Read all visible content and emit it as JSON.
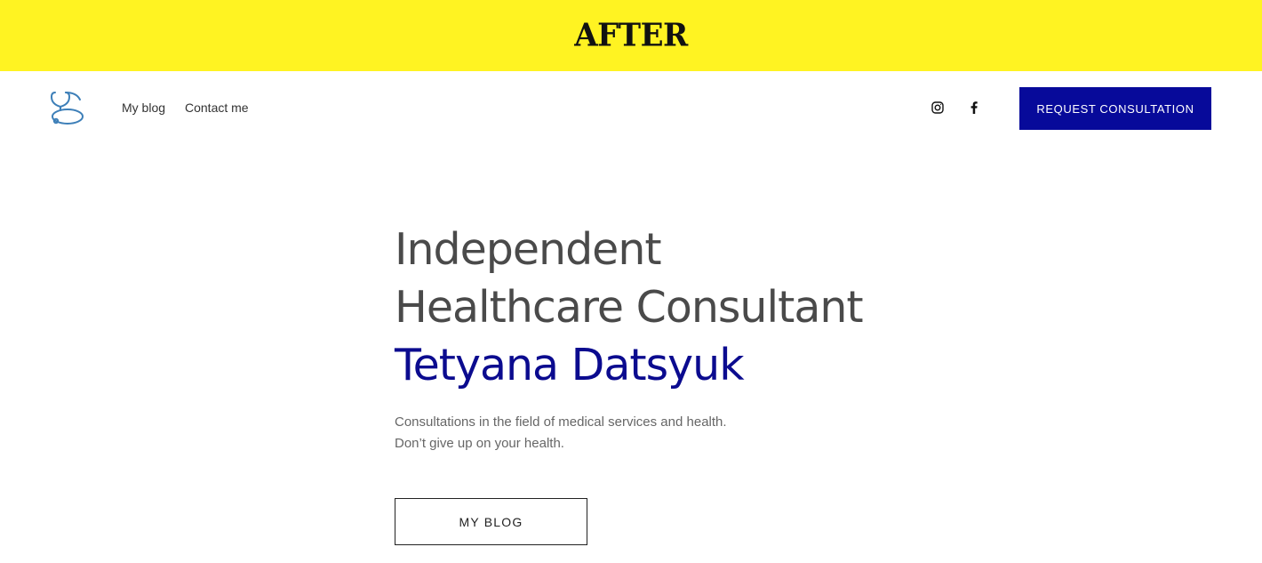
{
  "banner": {
    "label": "AFTER",
    "color": "#fff322"
  },
  "header": {
    "logo_icon": "stethoscope-icon",
    "nav": [
      {
        "label": "My blog"
      },
      {
        "label": "Contact me"
      }
    ],
    "social": [
      {
        "icon": "instagram-icon"
      },
      {
        "icon": "facebook-icon"
      }
    ],
    "cta_label": "REQUEST CONSULTATION",
    "cta_color": "#070a9a"
  },
  "hero": {
    "line1": "Independent",
    "line2": "Healthcare Consultant",
    "name": "Tetyana Datsyuk",
    "name_color": "#0b0b8f",
    "subtitle_line1": "Consultations in the field of medical services and health.",
    "subtitle_line2": "Don’t give up on your health.",
    "button_label": "MY BLOG"
  }
}
